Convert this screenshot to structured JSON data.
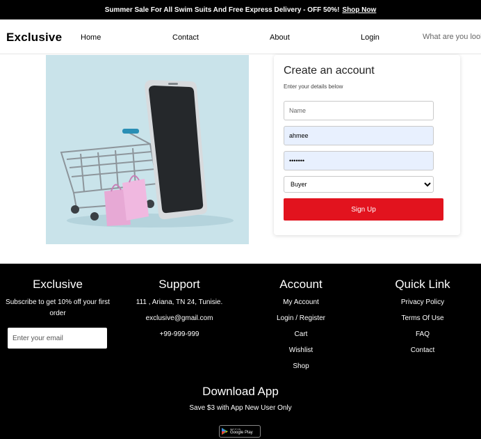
{
  "topbar": {
    "promo": "Summer Sale For All Swim Suits And Free Express Delivery - OFF 50%!",
    "shop_link": "Shop Now"
  },
  "nav": {
    "logo": "Exclusive",
    "links": [
      "Home",
      "Contact",
      "About",
      "Login"
    ],
    "search_placeholder": "What are you looking for?"
  },
  "signup": {
    "title": "Create an account",
    "subtitle": "Enter your details below",
    "name_placeholder": "Name",
    "email_value": "ahmee",
    "password_value": "•••••••",
    "role_selected": "Buyer",
    "button": "Sign Up"
  },
  "footer": {
    "exclusive": {
      "title": "Exclusive",
      "text": "Subscribe to get 10% off your first order",
      "email_placeholder": "Enter your email"
    },
    "support": {
      "title": "Support",
      "items": [
        "111 , Ariana, TN 24, Tunisie.",
        "exclusive@gmail.com",
        "+99-999-999"
      ]
    },
    "account": {
      "title": "Account",
      "items": [
        "My Account",
        "Login / Register",
        "Cart",
        "Wishlist",
        "Shop"
      ]
    },
    "quick": {
      "title": "Quick Link",
      "items": [
        "Privacy Policy",
        "Terms Of Use",
        "FAQ",
        "Contact"
      ]
    },
    "download": {
      "title": "Download App",
      "subtitle": "Save $3 with App New User Only",
      "badge_small": "GET IT ON",
      "badge_big": "Google Play"
    }
  },
  "colors": {
    "accent": "#e2131e",
    "hero_bg": "#c9e3ea",
    "autofill_bg": "#e8f0fe"
  }
}
